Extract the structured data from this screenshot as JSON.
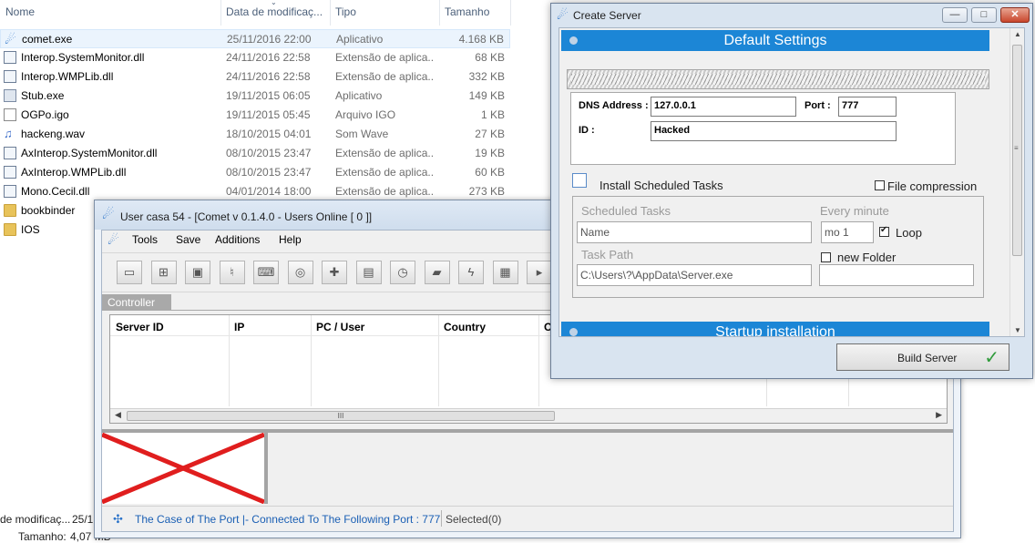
{
  "explorer": {
    "columns": [
      "Nome",
      "Data de modificaç...",
      "Tipo",
      "Tamanho"
    ],
    "files": [
      {
        "name": "comet.exe",
        "date": "25/11/2016 22:00",
        "type": "Aplicativo",
        "size": "4.168 KB",
        "icon": "comet-icon",
        "selected": true
      },
      {
        "name": "Interop.SystemMonitor.dll",
        "date": "24/11/2016 22:58",
        "type": "Extensão de aplica...",
        "size": "68 KB",
        "icon": "dll-icon"
      },
      {
        "name": "Interop.WMPLib.dll",
        "date": "24/11/2016 22:58",
        "type": "Extensão de aplica...",
        "size": "332 KB",
        "icon": "dll-icon"
      },
      {
        "name": "Stub.exe",
        "date": "19/11/2015 06:05",
        "type": "Aplicativo",
        "size": "149 KB",
        "icon": "exe-icon"
      },
      {
        "name": "OGPo.igo",
        "date": "19/11/2015 05:45",
        "type": "Arquivo IGO",
        "size": "1 KB",
        "icon": "file-icon"
      },
      {
        "name": "hackeng.wav",
        "date": "18/10/2015 04:01",
        "type": "Som Wave",
        "size": "27 KB",
        "icon": "audio-icon"
      },
      {
        "name": "AxInterop.SystemMonitor.dll",
        "date": "08/10/2015 23:47",
        "type": "Extensão de aplica...",
        "size": "19 KB",
        "icon": "dll-icon"
      },
      {
        "name": "AxInterop.WMPLib.dll",
        "date": "08/10/2015 23:47",
        "type": "Extensão de aplica...",
        "size": "60 KB",
        "icon": "dll-icon"
      },
      {
        "name": "Mono.Cecil.dll",
        "date": "04/01/2014 18:00",
        "type": "Extensão de aplica...",
        "size": "273 KB",
        "icon": "dll-icon"
      },
      {
        "name": "bookbinder",
        "date": "",
        "type": "",
        "size": "",
        "icon": "folder-icon"
      },
      {
        "name": "IOS",
        "date": "",
        "type": "",
        "size": "",
        "icon": "folder-icon"
      }
    ],
    "details": {
      "modified_label": "de modificaç...",
      "modified_value": "25/1",
      "size_label": "Tamanho:",
      "size_value": "4,07 MB"
    }
  },
  "comet": {
    "title": "User casa 54 - [Comet v 0.1.4.0 - Users Online [ 0 ]]",
    "menu": [
      "Tools",
      "Save",
      "Additions",
      "Help"
    ],
    "toolbar_icons": [
      "monitor-icon",
      "windows-icon",
      "remote-desktop-icon",
      "microphone-icon",
      "keyboard-icon",
      "webcam-icon",
      "puzzle-icon",
      "hdd-icon",
      "stopwatch-icon",
      "chat-icon",
      "power-icon",
      "chip-icon",
      "more-icon"
    ],
    "tab": "Controller",
    "columns": [
      "Server ID",
      "IP",
      "PC / User",
      "Country",
      "O"
    ],
    "status": "The Case of The Port |- Connected To The Following Port : 777",
    "selected": "Selected(0)"
  },
  "create_server": {
    "title": "Create Server",
    "section_default": "Default Settings",
    "dns_label": "DNS Address :",
    "dns_value": "127.0.0.1",
    "port_label": "Port :",
    "port_value": "777",
    "id_label": "ID :",
    "id_value": "Hacked",
    "install_tasks": "Install Scheduled Tasks",
    "file_compression": "File compression",
    "scheduled_tasks": "Scheduled Tasks",
    "name_placeholder": "Name",
    "every_minute": "Every minute",
    "every_value": "mo 1",
    "loop": "Loop",
    "task_path": "Task Path",
    "path_value": "C:\\Users\\?\\AppData\\Server.exe",
    "new_folder": "new Folder",
    "section_startup": "Startup installation",
    "build": "Build Server",
    "scrollbar_grip": "≡",
    "window_min": "—",
    "window_max": "□",
    "window_close": "✕"
  },
  "hscroll_grip": "III"
}
